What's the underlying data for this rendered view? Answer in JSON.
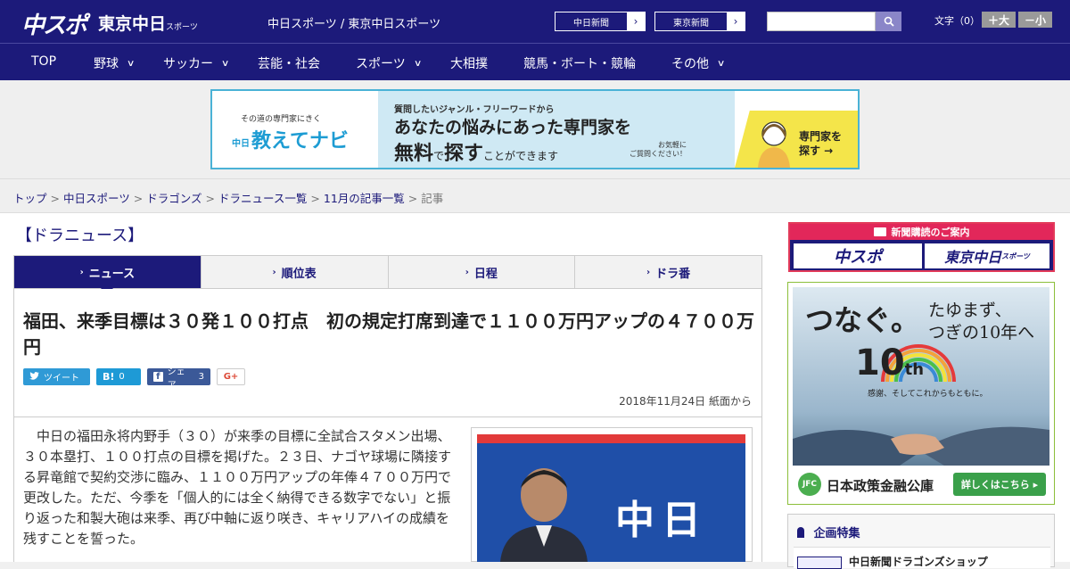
{
  "header": {
    "logo_main": "中スポ",
    "logo_tokyo": "東京中日",
    "logo_tokyo_sub": "スポーツ",
    "subtitle": "中日スポーツ / 東京中日スポーツ",
    "paper_links": [
      "中日新聞",
      "東京新聞"
    ],
    "text_size_label": "文字（0）",
    "size_up": "＋大",
    "size_down": "－小"
  },
  "nav": {
    "items": [
      {
        "label": "TOP",
        "dropdown": false
      },
      {
        "label": "野球",
        "dropdown": true
      },
      {
        "label": "サッカー",
        "dropdown": true
      },
      {
        "label": "芸能・社会",
        "dropdown": false
      },
      {
        "label": "スポーツ",
        "dropdown": true
      },
      {
        "label": "大相撲",
        "dropdown": false
      },
      {
        "label": "競馬・ボート・競輪",
        "dropdown": false
      },
      {
        "label": "その他",
        "dropdown": true
      }
    ]
  },
  "banner": {
    "tagline": "その道の専門家にきく",
    "brand_prefix": "中日",
    "brand": "教えてナビ",
    "line1": "質問したいジャンル・フリーワードから",
    "line2": "あなたの悩みにあった専門家を",
    "line3a": "無料",
    "line3b": "で",
    "line3c": "探す",
    "line3d": "ことができます",
    "note": "お気軽に\nご質問ください！",
    "cta": "専門家を\n探す →"
  },
  "breadcrumb": {
    "items": [
      "トップ",
      "中日スポーツ",
      "ドラゴンズ",
      "ドラニュース一覧",
      "11月の記事一覧"
    ],
    "current": "記事"
  },
  "section_title": "【ドラニュース】",
  "tabs": [
    {
      "label": "ニュース",
      "active": true
    },
    {
      "label": "順位表",
      "active": false
    },
    {
      "label": "日程",
      "active": false
    },
    {
      "label": "ドラ番",
      "active": false
    }
  ],
  "article": {
    "headline": "福田、来季目標は３０発１００打点　初の規定打席到達で１１００万円アップの４７００万円",
    "share": {
      "tweet": "ツイート",
      "hatena": "0",
      "facebook_label": "シェア",
      "facebook_count": "3",
      "google": "G+"
    },
    "date": "2018年11月24日 紙面から",
    "body": "中日の福田永将内野手（３０）が来季の目標に全試合スタメン出場、３０本塁打、１００打点の目標を掲げた。２３日、ナゴヤ球場に隣接する昇竜館で契約交渉に臨み、１１００万円アップの年俸４７００万円で更改した。ただ、今季を「個人的には全く納得できる数字でない」と振り返った和製大砲は来季、再び中軸に返り咲き、キャリアハイの成績を残すことを誓った。",
    "photo_text": "中日"
  },
  "sidebar": {
    "subscription_title": "新聞購読のご案内",
    "sub_logo_1": "中スポ",
    "sub_logo_2": "東京中日",
    "sub_logo_2_small": "スポーツ",
    "ad_tsunagu": "つなぐ。",
    "ad_tameru_1": "たゆまず、",
    "ad_tameru_2": "つぎの10年へ",
    "ad_10th_num": "10",
    "ad_10th_suffix": "th",
    "ad_kansha": "感謝、そしてこれからもともに。",
    "ad_jfc": "JFC",
    "ad_corp": "日本政策金融公庫",
    "ad_detail": "詳しくはこちら ▸",
    "feature_title": "企画特集",
    "feature_item": "中日新聞ドラゴンズショップ"
  },
  "colors": {
    "brand_navy": "#1c1a7a",
    "accent_pink": "#e2275a",
    "banner_border": "#4ab2d6",
    "ad_green": "#3aa04a"
  }
}
